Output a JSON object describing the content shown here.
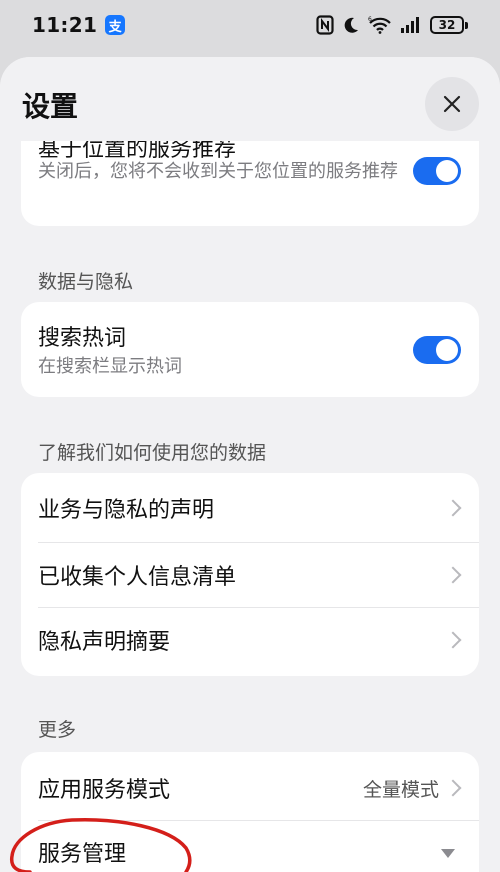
{
  "status_bar": {
    "time": "11:21",
    "app_badge": "支",
    "battery": "32"
  },
  "sheet": {
    "title": "设置"
  },
  "location_card": {
    "title": "基于位置的服务推荐",
    "subtitle": "关闭后，您将不会收到关于您位置的服务推荐",
    "toggle_on": true
  },
  "data_privacy": {
    "header": "数据与隐私",
    "title": "搜索热词",
    "subtitle": "在搜索栏显示热词",
    "toggle_on": true
  },
  "learn": {
    "header": "了解我们如何使用您的数据",
    "items": [
      {
        "label": "业务与隐私的声明"
      },
      {
        "label": "已收集个人信息清单"
      },
      {
        "label": "隐私声明摘要"
      }
    ]
  },
  "more": {
    "header": "更多",
    "items": [
      {
        "label": "应用服务模式",
        "value": "全量模式"
      },
      {
        "label": "服务管理"
      }
    ]
  },
  "colors": {
    "accent": "#1a6cf0",
    "annotation": "#d41f1a",
    "sheet_bg": "#f1f1f3"
  }
}
